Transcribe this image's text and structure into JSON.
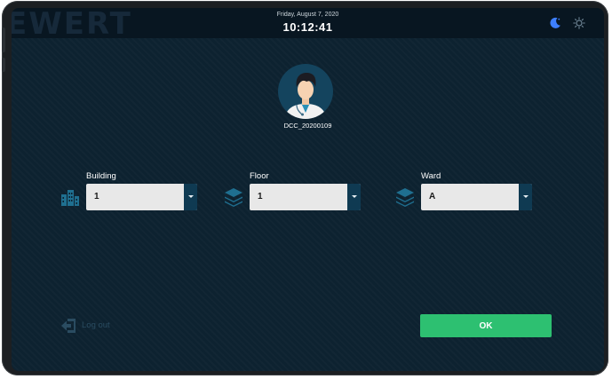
{
  "header": {
    "brand": "EWERT",
    "date": "Friday, August 7, 2020",
    "time": "10:12:41"
  },
  "theme_toggle": {
    "dark_icon": "moon-icon",
    "light_icon": "sun-icon",
    "active_color": "#3d7fff"
  },
  "user": {
    "avatar_icon": "doctor-avatar-icon",
    "id": "DCC_20200109"
  },
  "fields": {
    "building": {
      "label": "Building",
      "value": "1",
      "icon": "building-icon"
    },
    "floor": {
      "label": "Floor",
      "value": "1",
      "icon": "layers-icon"
    },
    "ward": {
      "label": "Ward",
      "value": "A",
      "icon": "layers-icon"
    }
  },
  "actions": {
    "logout_label": "Log out",
    "logout_icon": "logout-icon",
    "ok_label": "OK",
    "ok_color": "#2dc071"
  }
}
